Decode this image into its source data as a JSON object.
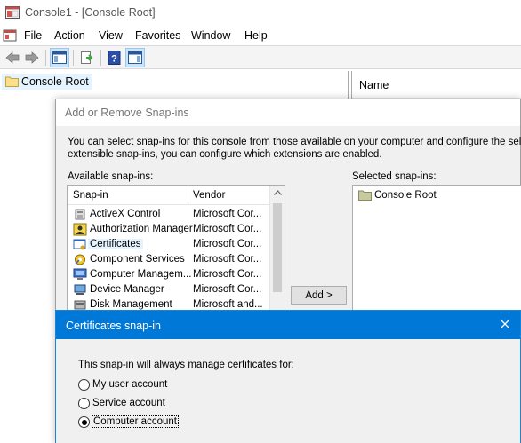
{
  "window": {
    "title": "Console1 - [Console Root]"
  },
  "menu": [
    "File",
    "Action",
    "View",
    "Favorites",
    "Window",
    "Help"
  ],
  "toolbar": {
    "icons": [
      "back-arrow-icon",
      "forward-arrow-icon",
      "show-hide-tree-icon",
      "export-list-icon",
      "help-icon",
      "show-hide-action-pane-icon"
    ]
  },
  "tree": {
    "root": "Console Root"
  },
  "list": {
    "column_name": "Name"
  },
  "snapin_dialog": {
    "title": "Add or Remove Snap-ins",
    "description_line1": "You can select snap-ins for this console from those available on your computer and configure the selected",
    "description_line2": "extensible snap-ins, you can configure which extensions are enabled.",
    "available_label": "Available snap-ins:",
    "selected_label": "Selected snap-ins:",
    "col_snapin": "Snap-in",
    "col_vendor": "Vendor",
    "rows": [
      {
        "name": "ActiveX Control",
        "vendor": "Microsoft Cor...",
        "icon": "activex-control-icon"
      },
      {
        "name": "Authorization Manager",
        "vendor": "Microsoft Cor...",
        "icon": "authorization-manager-icon"
      },
      {
        "name": "Certificates",
        "vendor": "Microsoft Cor...",
        "icon": "certificates-icon"
      },
      {
        "name": "Component Services",
        "vendor": "Microsoft Cor...",
        "icon": "component-services-icon"
      },
      {
        "name": "Computer Managem...",
        "vendor": "Microsoft Cor...",
        "icon": "computer-management-icon"
      },
      {
        "name": "Device Manager",
        "vendor": "Microsoft Cor...",
        "icon": "device-manager-icon"
      },
      {
        "name": "Disk Management",
        "vendor": "Microsoft and...",
        "icon": "disk-management-icon"
      }
    ],
    "add_button": "Add >",
    "selected_items": [
      "Console Root"
    ]
  },
  "cert_dialog": {
    "title": "Certificates snap-in",
    "prompt": "This snap-in will always manage certificates for:",
    "options": [
      {
        "label": "My user account",
        "checked": false
      },
      {
        "label": "Service account",
        "checked": false
      },
      {
        "label": "Computer account",
        "checked": true
      }
    ]
  },
  "colors": {
    "accent": "#0078d7",
    "selection": "#e5f3ff",
    "dialog_bg": "#f0f0f0"
  }
}
